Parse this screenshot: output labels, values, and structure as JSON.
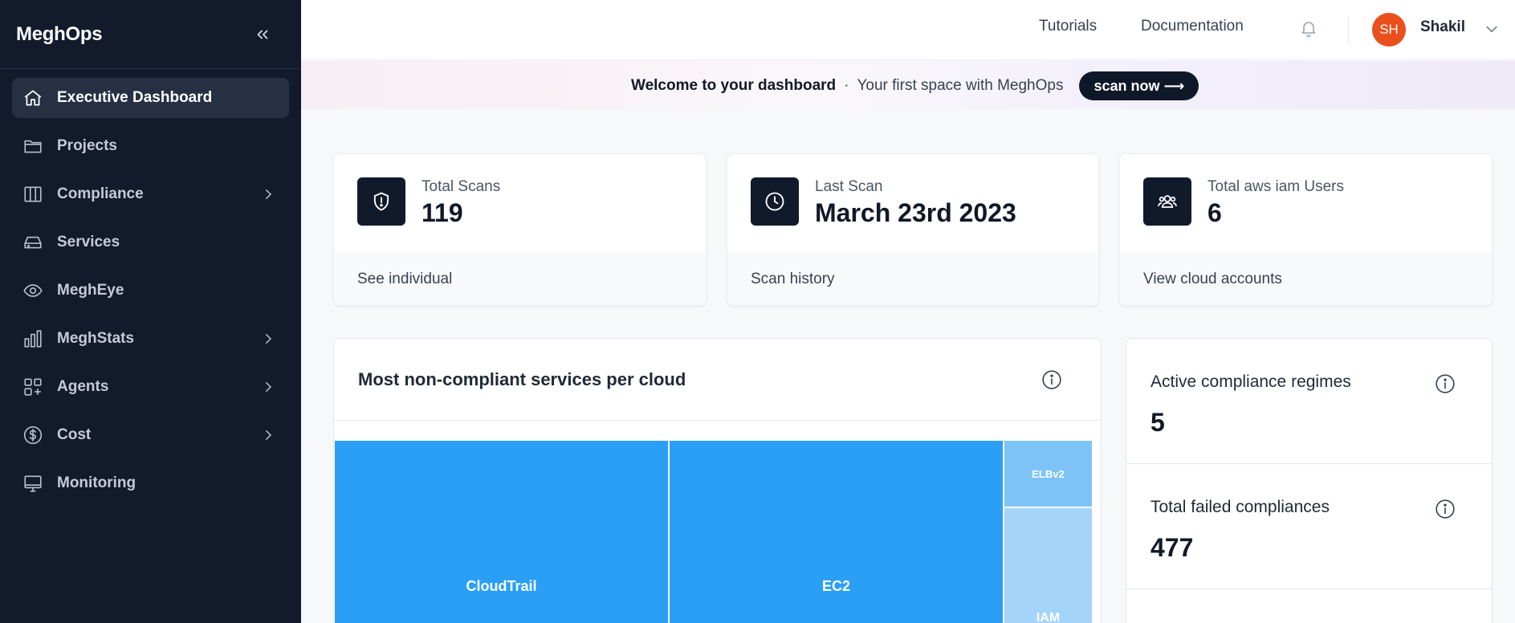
{
  "sidebar": {
    "brand": "MeghOps",
    "items": [
      {
        "label": "Executive Dashboard",
        "icon": "home-icon",
        "active": true,
        "has_submenu": false
      },
      {
        "label": "Projects",
        "icon": "folder-icon",
        "active": false,
        "has_submenu": false
      },
      {
        "label": "Compliance",
        "icon": "columns-icon",
        "active": false,
        "has_submenu": true
      },
      {
        "label": "Services",
        "icon": "hard-drive-icon",
        "active": false,
        "has_submenu": false
      },
      {
        "label": "MeghEye",
        "icon": "eye-icon",
        "active": false,
        "has_submenu": false
      },
      {
        "label": "MeghStats",
        "icon": "bar-chart-icon",
        "active": false,
        "has_submenu": true
      },
      {
        "label": "Agents",
        "icon": "apps-add-icon",
        "active": false,
        "has_submenu": true
      },
      {
        "label": "Cost",
        "icon": "dollar-icon",
        "active": false,
        "has_submenu": true
      },
      {
        "label": "Monitoring",
        "icon": "monitor-icon",
        "active": false,
        "has_submenu": false
      }
    ]
  },
  "topbar": {
    "tutorials": "Tutorials",
    "documentation": "Documentation",
    "avatar_initials": "SH",
    "user_name": "Shakil"
  },
  "banner": {
    "title": "Welcome to your dashboard",
    "separator": "·",
    "subtitle": "Your first space with MeghOps",
    "button": "scan now ⟶"
  },
  "stats": [
    {
      "label": "Total Scans",
      "value": "119",
      "link": "See individual",
      "icon": "shield-alert-icon"
    },
    {
      "label": "Last Scan",
      "value": "March 23rd 2023",
      "link": "Scan history",
      "icon": "clock-icon"
    },
    {
      "label": "Total aws iam Users",
      "value": "6",
      "link": "View cloud accounts",
      "icon": "users-icon"
    }
  ],
  "chart": {
    "title": "Most non-compliant services per cloud"
  },
  "chart_data": {
    "type": "treemap",
    "title": "Most non-compliant services per cloud",
    "tiles": [
      {
        "label": "CloudTrail",
        "weight": 44.2,
        "color": "#2a9ff5"
      },
      {
        "label": "EC2",
        "weight": 44.2,
        "color": "#2a9ff5"
      },
      {
        "label": "ELBv2",
        "weight": 1.9,
        "color": "#7ec3f8"
      },
      {
        "label": "IAM",
        "weight": 9.7,
        "color": "#a5d4fb"
      }
    ]
  },
  "summary": [
    {
      "label": "Active compliance regimes",
      "value": "5"
    },
    {
      "label": "Total failed compliances",
      "value": "477"
    }
  ],
  "colors": {
    "sidebar_bg": "#121a2c",
    "accent_dark": "#111a2b",
    "avatar": "#ea4f1c",
    "treemap_primary": "#2a9ff5"
  }
}
